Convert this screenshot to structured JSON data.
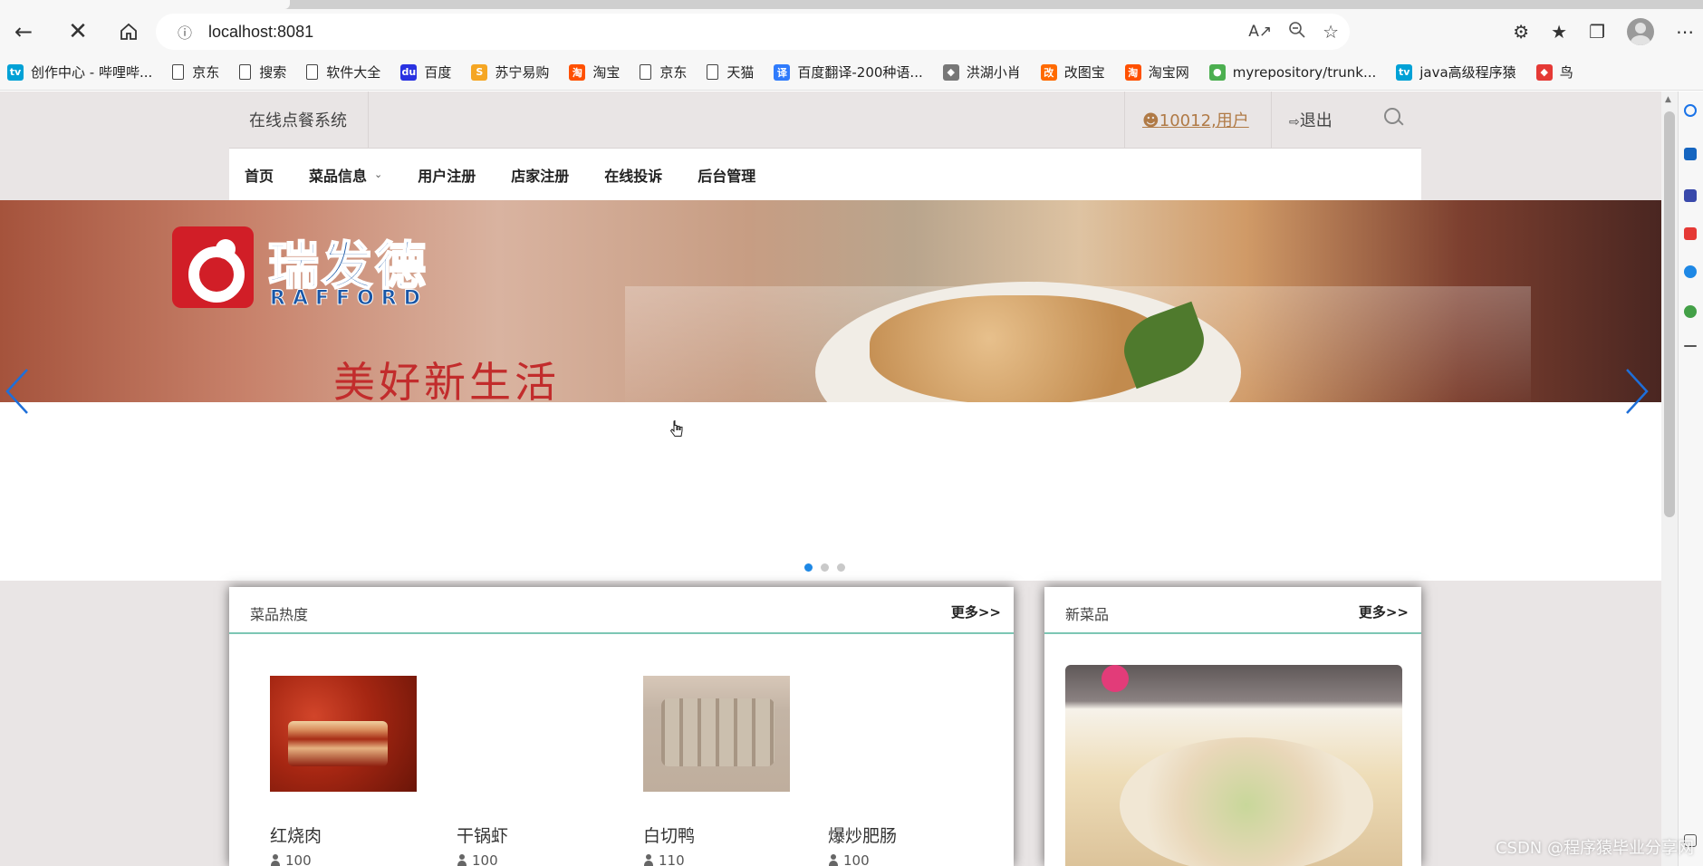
{
  "browser": {
    "url": "localhost:8081",
    "bookmarks": [
      {
        "label": "创作中心 - 哔哩哔...",
        "icon": "bilibili-icon",
        "color": "#00a1d6"
      },
      {
        "label": "京东",
        "icon": "page-icon"
      },
      {
        "label": "搜索",
        "icon": "page-icon"
      },
      {
        "label": "软件大全",
        "icon": "page-icon"
      },
      {
        "label": "百度",
        "icon": "baidu-icon",
        "color": "#2932e1"
      },
      {
        "label": "苏宁易购",
        "icon": "suning-icon",
        "color": "#f5a623"
      },
      {
        "label": "淘宝",
        "icon": "taobao-icon",
        "color": "#ff5000"
      },
      {
        "label": "京东",
        "icon": "page-icon"
      },
      {
        "label": "天猫",
        "icon": "page-icon"
      },
      {
        "label": "百度翻译-200种语...",
        "icon": "translate-icon",
        "color": "#2f7bfc"
      },
      {
        "label": "洪湖小肖",
        "icon": "bird-icon",
        "color": "#777777"
      },
      {
        "label": "改图宝",
        "icon": "gaitubao-icon",
        "color": "#ff6a00"
      },
      {
        "label": "淘宝网",
        "icon": "taobao-icon",
        "color": "#ff5000"
      },
      {
        "label": "myrepository/trunk...",
        "icon": "chrome-icon",
        "color": "#4caf50"
      },
      {
        "label": "java高级程序猿",
        "icon": "bilibili-icon",
        "color": "#00a1d6"
      },
      {
        "label": "鸟",
        "icon": "bird-icon",
        "color": "#e53935"
      }
    ]
  },
  "header": {
    "site_title": "在线点餐系统",
    "user_link": "10012,用户",
    "logout": "退出"
  },
  "nav": {
    "items": [
      {
        "label": "首页"
      },
      {
        "label": "菜品信息",
        "has_dropdown": true
      },
      {
        "label": "用户注册"
      },
      {
        "label": "店家注册"
      },
      {
        "label": "在线投诉"
      },
      {
        "label": "后台管理"
      }
    ]
  },
  "banner": {
    "brand_cn": "瑞发德",
    "brand_en": "RAFFORD",
    "slogan": "美好新生活",
    "slides_total": 3,
    "active_slide": 1
  },
  "hot_dishes": {
    "title": "菜品热度",
    "more": "更多>>",
    "items": [
      {
        "name": "红烧肉",
        "count": "100",
        "has_image": true
      },
      {
        "name": "干锅虾",
        "count": "100",
        "has_image": false
      },
      {
        "name": "白切鸭",
        "count": "110",
        "has_image": true
      },
      {
        "name": "爆炒肥肠",
        "count": "100",
        "has_image": false
      }
    ]
  },
  "new_dishes": {
    "title": "新菜品",
    "more": "更多>>"
  },
  "watermark": "CSDN @程序猿毕业分享网",
  "colors": {
    "accent_line": "#7cc6b4",
    "user_link": "#b07a46",
    "active_dot": "#1e88e5",
    "page_bg": "#e9e5e5"
  }
}
